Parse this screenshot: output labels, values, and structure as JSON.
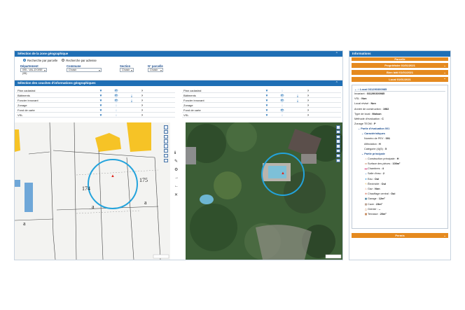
{
  "geo": {
    "title": "Sélection de la zone géographique",
    "radio_parcel": "Recherche par parcelle",
    "radio_address": "Recherche par adresse",
    "labels": {
      "departement": "Département",
      "commune": "Commune",
      "section": "Section",
      "parcelle": "N° parcelle"
    },
    "values": {
      "departement": "095 - VAL-D'OISE (95)",
      "commune": "Choisir",
      "section": "Choisir",
      "parcelle": "Choisir"
    }
  },
  "layers": {
    "title": "Sélection des couches d'informations géographiques",
    "left": [
      "Plan cadastral",
      "Bâtiments",
      "Foncier innovant",
      "Zonage",
      "Fond de carte",
      "VSL"
    ],
    "right": [
      "Plan cadastral",
      "Bâtiments",
      "Foncier innovant",
      "Zonage",
      "Fond de carte",
      "VSL"
    ],
    "help": "?"
  },
  "map": {
    "parcel_a": "174",
    "parcel_b": "175",
    "label_a1": "a",
    "label_a2": "a",
    "label_a3": "a"
  },
  "info": {
    "title": "Informations",
    "tabs": [
      "Parcelle",
      "Propriétaire 01/01/2021",
      "Bien bâti 01/01/2021",
      "Local 01/01/2021"
    ],
    "local": {
      "header": "Local 031290300985",
      "rows": [
        {
          "k": "Invariant : ",
          "v": "031290300985"
        },
        {
          "k": "VSL : ",
          "v": "Non"
        },
        {
          "k": "Local révisé : ",
          "v": "Non"
        },
        {
          "k": "Année de construction : ",
          "v": "1982"
        },
        {
          "k": "Type de local : ",
          "v": "Maison"
        },
        {
          "k": "Méthode d'évaluation : ",
          "v": "C"
        },
        {
          "k": "Zonage TEOM : ",
          "v": "P"
        }
      ],
      "eval_part": "Partie d'évaluation 001",
      "characteristics": "Caractéristiques",
      "char_rows": [
        {
          "k": "Numéro de PEV : ",
          "v": "001"
        },
        {
          "k": "Affectation : ",
          "v": "H"
        },
        {
          "k": "Catégorie (4)(5) : ",
          "v": "5"
        }
      ],
      "main_part": "Partie principale",
      "main_rows": [
        {
          "icon": "house-icon",
          "k": "Construction principale : ",
          "v": "H"
        },
        {
          "icon": "ruler-icon",
          "k": "Surface des pièces : ",
          "v": "100m²"
        },
        {
          "icon": "bed-icon",
          "k": "Chambres : ",
          "v": "4"
        },
        {
          "icon": "bath-icon",
          "k": "Salle d'eau : ",
          "v": "2"
        },
        {
          "icon": "water-icon",
          "k": "Eau : ",
          "v": "Oui"
        },
        {
          "icon": "electricity-icon",
          "k": "Électricité : ",
          "v": "Oui"
        },
        {
          "icon": "gas-icon",
          "k": "Gaz : ",
          "v": "Non"
        },
        {
          "icon": "heating-icon",
          "k": "Chauffage central : ",
          "v": "Oui"
        },
        {
          "icon": "garage-icon",
          "k": "Garage : ",
          "v": "12m²"
        },
        {
          "icon": "cellar-icon",
          "k": "Cave : ",
          "v": "23m²"
        },
        {
          "icon": "attic-icon",
          "k": "Grenier : ",
          "v": "--"
        },
        {
          "icon": "terrace-icon",
          "k": "Terrasse : ",
          "v": "20m²"
        }
      ]
    },
    "permis": "Permis"
  },
  "colors": {
    "blue": "#1f6fb5",
    "orange": "#e58a1f",
    "circle": "#23a3dc",
    "marker": "#e0241b"
  }
}
